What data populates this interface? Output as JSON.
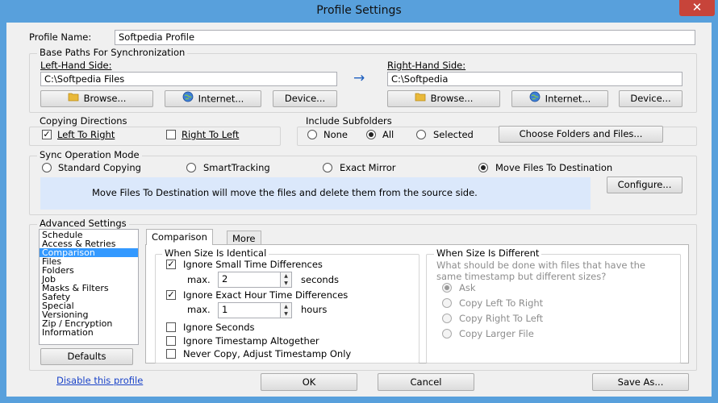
{
  "window": {
    "title": "Profile Settings",
    "close_glyph": "✕"
  },
  "profile": {
    "label": "Profile Name:",
    "value": "Softpedia Profile"
  },
  "base_paths": {
    "title": "Base Paths For Synchronization",
    "left": {
      "label": "Left-Hand Side:",
      "value": "C:\\Softpedia Files"
    },
    "right": {
      "label": "Right-Hand Side:",
      "value": "C:\\Softpedia"
    },
    "arrow": "→",
    "browse": "Browse...",
    "internet": "Internet...",
    "device": "Device..."
  },
  "copying": {
    "title": "Copying Directions",
    "left_to_right": "Left To Right",
    "right_to_left": "Right To Left",
    "left_to_right_checked": true,
    "right_to_left_checked": false
  },
  "subfolders": {
    "title": "Include Subfolders",
    "none": "None",
    "all": "All",
    "selected": "Selected",
    "choose_button": "Choose Folders and Files...",
    "value": "All"
  },
  "sync_mode": {
    "title": "Sync Operation Mode",
    "options": [
      "Standard Copying",
      "SmartTracking",
      "Exact Mirror",
      "Move Files To Destination"
    ],
    "selected": "Move Files To Destination",
    "description": "Move Files To Destination will move the files and delete them from the source side.",
    "configure": "Configure..."
  },
  "advanced": {
    "title": "Advanced Settings",
    "list": [
      "Schedule",
      "Access & Retries",
      "Comparison",
      "Files",
      "Folders",
      "Job",
      "Masks & Filters",
      "Safety",
      "Special",
      "Versioning",
      "Zip / Encryption",
      "Information"
    ],
    "selected": "Comparison",
    "defaults": "Defaults",
    "tabs": [
      "Comparison",
      "More"
    ],
    "active_tab": "Comparison",
    "identical": {
      "title": "When Size Is Identical",
      "ignore_small": "Ignore Small Time Differences",
      "ignore_small_checked": true,
      "max_label": "max.",
      "small_value": "2",
      "seconds": "seconds",
      "ignore_hour": "Ignore Exact Hour Time Differences",
      "ignore_hour_checked": true,
      "hour_value": "1",
      "hours": "hours",
      "ignore_seconds": "Ignore Seconds",
      "ignore_altogether": "Ignore Timestamp Altogether",
      "never_copy": "Never Copy, Adjust Timestamp Only"
    },
    "different": {
      "title": "When Size Is Different",
      "question": "What should be done with files that have the same timestamp but different sizes?",
      "options": [
        "Ask",
        "Copy Left To Right",
        "Copy Right To Left",
        "Copy Larger File"
      ],
      "selected": "Ask"
    }
  },
  "footer": {
    "disable_link": "Disable this profile",
    "ok": "OK",
    "cancel": "Cancel",
    "save_as": "Save As..."
  }
}
